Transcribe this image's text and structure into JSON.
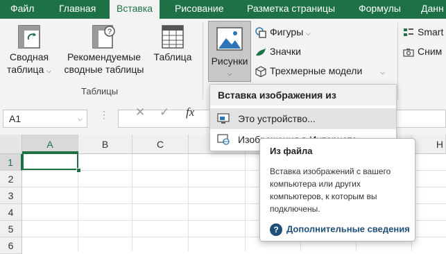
{
  "tabs": [
    "Файл",
    "Главная",
    "Вставка",
    "Рисование",
    "Разметка страницы",
    "Формулы",
    "Данн"
  ],
  "active_tab": "Вставка",
  "ribbon": {
    "pivot_table": [
      "Сводная",
      "таблица"
    ],
    "recommended_pivot": [
      "Рекомендуемые",
      "сводные таблицы"
    ],
    "table": "Таблица",
    "group_tables": "Таблицы",
    "pictures": "Рисунки",
    "shapes": "Фигуры",
    "icons": "Значки",
    "models_3d": "Трехмерные модели",
    "smartart": "Smart",
    "screenshot": "Сним"
  },
  "formula_bar": {
    "name_box": "A1",
    "fx_symbol": "fx",
    "cancel_icon": "close-icon",
    "enter_icon": "check-icon"
  },
  "grid": {
    "columns": [
      "A",
      "B",
      "C",
      "",
      "",
      "",
      "",
      "H"
    ],
    "rows": [
      "1",
      "2",
      "3",
      "4",
      "5",
      "6"
    ],
    "active_cell": "A1"
  },
  "menu": {
    "header": "Вставка изображения из",
    "item_device": "Это устройство...",
    "item_online": "Изображения в Интернете"
  },
  "tooltip": {
    "title": "Из файла",
    "lines": [
      "Вставка изображений с вашего",
      "компьютера или других",
      "компьютеров, к которым вы",
      "подключены."
    ],
    "link": "Дополнительные сведения"
  },
  "colors": {
    "accent": "#1e7145",
    "link": "#1f4e79"
  }
}
